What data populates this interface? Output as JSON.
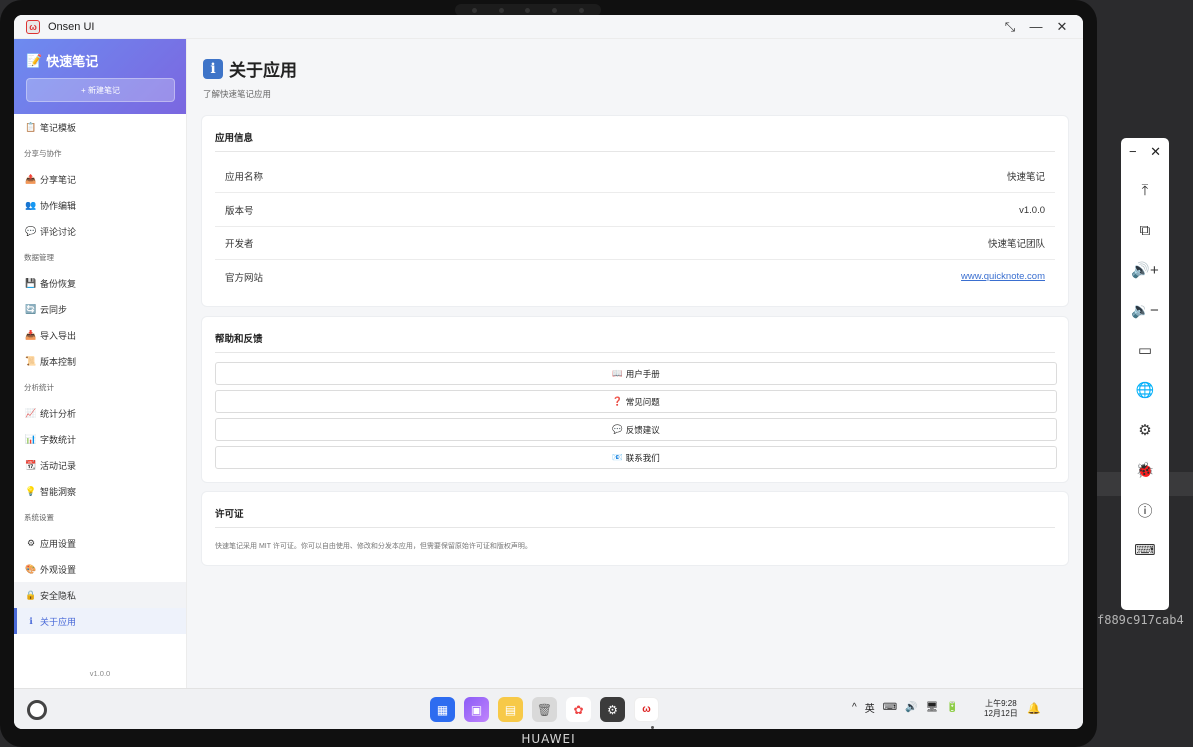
{
  "window": {
    "title": "Onsen UI",
    "controls": [
      "⤡",
      "—",
      "✕"
    ]
  },
  "sidebar": {
    "title": "快速笔记",
    "title_icon": "📝",
    "new_button": "+ 新建笔记",
    "items": [
      {
        "type": "item",
        "icon": "📋",
        "label": "笔记模板"
      },
      {
        "type": "group",
        "label": "分享与协作"
      },
      {
        "type": "item",
        "icon": "📤",
        "label": "分享笔记"
      },
      {
        "type": "item",
        "icon": "👥",
        "label": "协作编辑"
      },
      {
        "type": "item",
        "icon": "💬",
        "label": "评论讨论"
      },
      {
        "type": "group",
        "label": "数据管理"
      },
      {
        "type": "item",
        "icon": "💾",
        "label": "备份恢复"
      },
      {
        "type": "item",
        "icon": "🔄",
        "label": "云同步"
      },
      {
        "type": "item",
        "icon": "📥",
        "label": "导入导出"
      },
      {
        "type": "item",
        "icon": "📜",
        "label": "版本控制"
      },
      {
        "type": "group",
        "label": "分析统计"
      },
      {
        "type": "item",
        "icon": "📈",
        "label": "统计分析"
      },
      {
        "type": "item",
        "icon": "📊",
        "label": "字数统计"
      },
      {
        "type": "item",
        "icon": "📆",
        "label": "活动记录"
      },
      {
        "type": "item",
        "icon": "💡",
        "label": "智能洞察"
      },
      {
        "type": "group",
        "label": "系统设置"
      },
      {
        "type": "item",
        "icon": "⚙",
        "label": "应用设置"
      },
      {
        "type": "item",
        "icon": "🎨",
        "label": "外观设置"
      },
      {
        "type": "item",
        "icon": "🔒",
        "label": "安全隐私",
        "state": "hover"
      },
      {
        "type": "item",
        "icon": "ℹ",
        "label": "关于应用",
        "state": "active"
      }
    ],
    "version": "v1.0.0"
  },
  "main": {
    "title": "关于应用",
    "title_icon": "i",
    "subtitle": "了解快速笔记应用",
    "app_info": {
      "title": "应用信息",
      "rows": [
        {
          "label": "应用名称",
          "value": "快速笔记"
        },
        {
          "label": "版本号",
          "value": "v1.0.0"
        },
        {
          "label": "开发者",
          "value": "快速笔记团队"
        },
        {
          "label": "官方网站",
          "value": "www.quicknote.com",
          "link": true
        }
      ]
    },
    "help": {
      "title": "帮助和反馈",
      "buttons": [
        {
          "icon": "📖",
          "label": "用户手册"
        },
        {
          "icon": "❓",
          "label": "常见问题"
        },
        {
          "icon": "💬",
          "label": "反馈建议"
        },
        {
          "icon": "📧",
          "label": "联系我们"
        }
      ]
    },
    "license": {
      "title": "许可证",
      "text": "快速笔记采用 MIT 许可证。你可以自由使用、修改和分发本应用，但需要保留原始许可证和版权声明。"
    }
  },
  "taskbar": {
    "clock_time": "上午9:28",
    "clock_date": "12月12日",
    "tray_icons": [
      "^",
      "英",
      "⌨",
      "🔊",
      "🖥",
      "🔋"
    ],
    "pinned_app_label": "Onsen UI"
  },
  "device": {
    "brand": "HUAWEI"
  },
  "right_toolbar": {
    "top": [
      "−",
      "✕"
    ],
    "icons": [
      "⤒",
      "⧉",
      "🔊+",
      "🔉−",
      "▭",
      "🌐",
      "⚙",
      "🐞",
      "ⓘ",
      "⌨"
    ]
  },
  "background": {
    "hash_text": "f889c917cab4"
  }
}
